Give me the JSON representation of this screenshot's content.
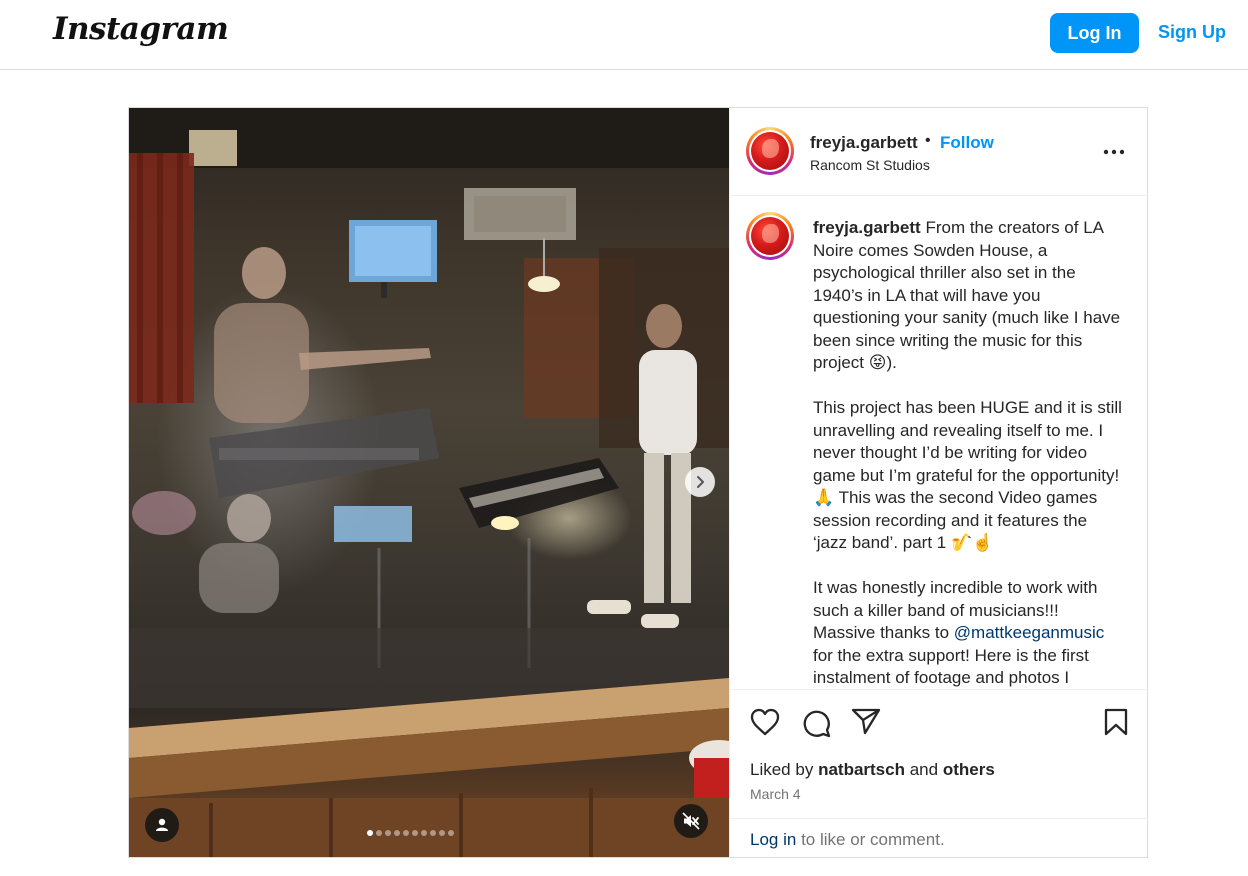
{
  "header": {
    "logo": "Instagram",
    "login_label": "Log In",
    "signup_label": "Sign Up",
    "accent_color": "#0095f6"
  },
  "post": {
    "author": "freyja.garbett",
    "separator": "•",
    "follow_label": "Follow",
    "location": "Rancom St Studios",
    "caption_paragraphs": [
      "From the creators of LA Noire comes Sowden House, a psychological thriller also set in the 1940’s in LA that will have you questioning your sanity (much like I have been since writing the music for this project 😝).",
      "This project has been HUGE and it is still unravelling and revealing itself to me. I never thought I’d be writing for video game but I’m grateful for the opportunity! 🙏 This was the second Video games session recording and it features the ‘jazz band’. part 1 🎷☝️",
      "It was honestly incredible to work with such a killer band of musicians!!!"
    ],
    "caption_p3_before": "Massive thanks to",
    "caption_mention": "@mattkeeganmusic",
    "caption_p3_after": "for the extra support! Here is the first instalment of footage and photos I",
    "liked_prefix": "Liked by",
    "liked_user": "natbartsch",
    "liked_and": "and",
    "liked_others": "others",
    "date": "March 4",
    "comment_link": "Log in",
    "comment_rest": "to like or comment.",
    "carousel": {
      "total": 10,
      "current": 1
    }
  },
  "icons": [
    "like-heart-icon",
    "comment-icon",
    "share-icon",
    "save-bookmark-icon",
    "more-options-icon",
    "user-tag-icon",
    "mute-icon",
    "next-arrow-icon"
  ]
}
